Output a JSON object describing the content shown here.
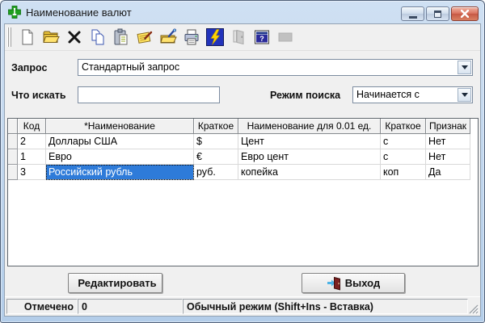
{
  "window": {
    "title": "Наименование валют"
  },
  "titlebar_controls": {
    "minimize": "minimize",
    "maximize": "maximize",
    "close": "close"
  },
  "toolbar": {
    "icons": [
      "new-icon",
      "open-icon",
      "delete-icon",
      "copy-icon",
      "paste-icon",
      "edit-note-icon",
      "edit-folder-icon",
      "print-icon",
      "execute-icon",
      "exit-disabled-icon",
      "help-icon",
      "blank-disabled-icon"
    ]
  },
  "query": {
    "label": "Запрос",
    "value": "Стандартный запрос"
  },
  "search": {
    "label": "Что искать",
    "value": "",
    "mode_label": "Режим поиска",
    "mode_value": "Начинается с"
  },
  "grid": {
    "columns": [
      "Код",
      "*Наименование",
      "Краткое",
      "Наименование для 0.01 ед.",
      "Краткое",
      "Признак"
    ],
    "rows": [
      [
        "2",
        "Доллары США",
        "$",
        "Цент",
        "с",
        "Нет"
      ],
      [
        "1",
        "Евро",
        "€",
        "Евро цент",
        "с",
        "Нет"
      ],
      [
        "3",
        "Российский рубль",
        "руб.",
        "копейка",
        "коп",
        "Да"
      ]
    ],
    "selected_row_code": "3",
    "selected_column": "*Наименование",
    "selected_value": "Российский рубль"
  },
  "buttons": {
    "edit": "Редактировать",
    "exit": "Выход"
  },
  "statusbar": {
    "marked_label": "Отмечено",
    "marked_count": "0",
    "mode_text": "Обычный режим (Shift+Ins - Вставка)"
  },
  "colors": {
    "selection": "#2e7bd9",
    "titlebar_top": "#cfe0f3",
    "titlebar_bottom": "#b3cde9",
    "close_button": "#c65743",
    "execute_icon_bg": "#2233bb",
    "lightning": "#ffd400",
    "app_cross_green": "#1fa01f"
  }
}
